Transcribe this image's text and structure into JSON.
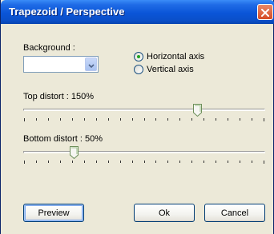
{
  "window": {
    "title": "Trapezoid / Perspective"
  },
  "background": {
    "label": "Background :",
    "value": ""
  },
  "axis": {
    "options": [
      {
        "label": "Horizontal axis",
        "checked": true
      },
      {
        "label": "Vertical axis",
        "checked": false
      }
    ]
  },
  "top_distort": {
    "label": "Top distort : 150%",
    "value_fraction": 0.73
  },
  "bottom_distort": {
    "label": "Bottom distort : 50%",
    "value_fraction": 0.2
  },
  "buttons": {
    "preview": "Preview",
    "ok": "Ok",
    "cancel": "Cancel"
  },
  "colors": {
    "title_bar": "#0a55d8",
    "close_button": "#d64a24",
    "dialog_background": "#ece9d8",
    "radio_dot": "#21a121"
  },
  "icons": {
    "close": "close-icon",
    "dropdown": "chevron-down-icon"
  }
}
